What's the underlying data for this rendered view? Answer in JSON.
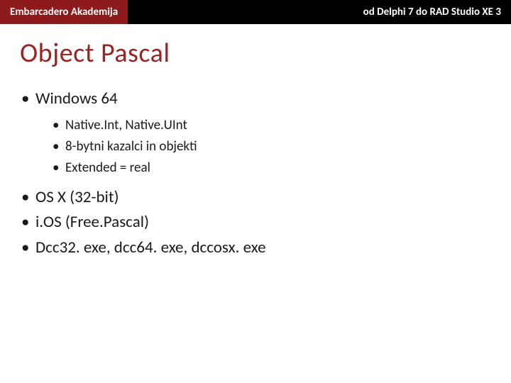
{
  "header": {
    "left": "Embarcadero Akademija",
    "right": "od Delphi 7 do RAD Studio XE 3"
  },
  "title": "Object Pascal",
  "bullets": [
    {
      "text": "Windows 64",
      "sub": [
        "Native.Int, Native.UInt",
        "8-bytni kazalci in objekti",
        "Extended = real"
      ]
    },
    {
      "text": "OS X (32-bit)"
    },
    {
      "text": "i.OS (Free.Pascal)"
    },
    {
      "text": "Dcc32. exe, dcc64. exe, dccosx. exe"
    }
  ]
}
